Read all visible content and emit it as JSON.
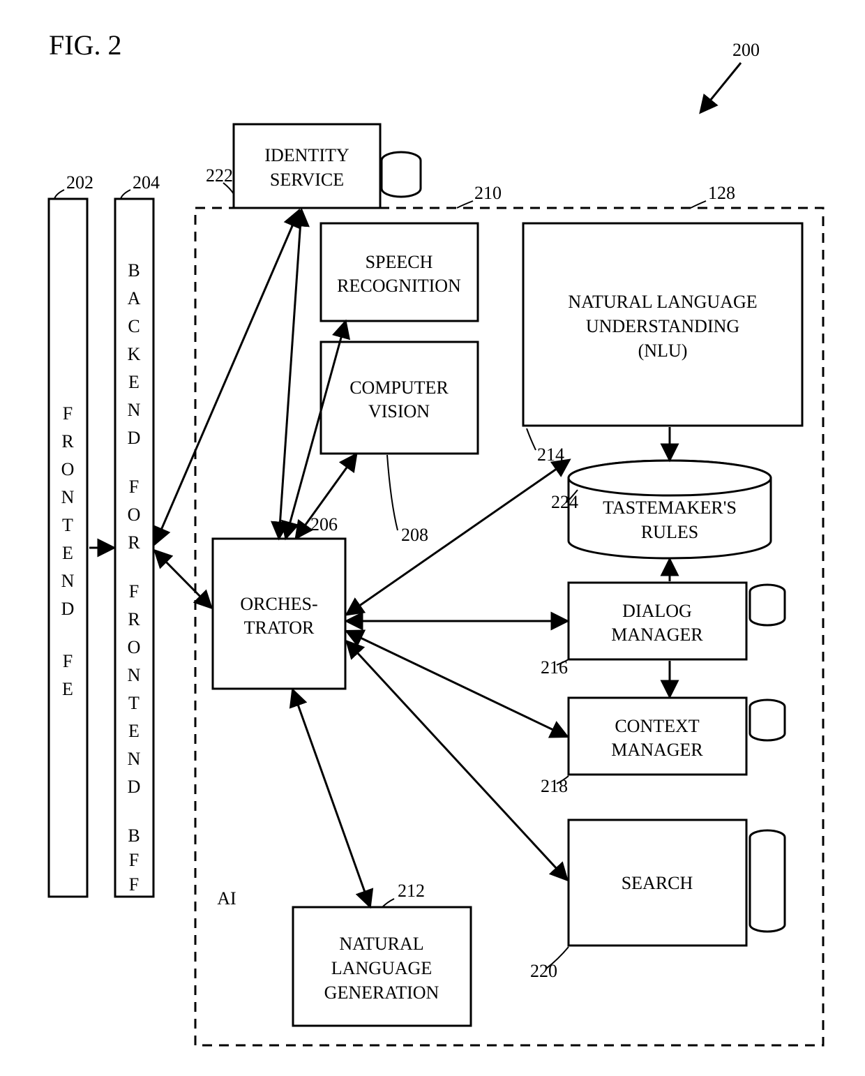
{
  "figure_label": "FIG. 2",
  "callout_200": "200",
  "blocks": {
    "frontend_line1": "FRONTEND",
    "frontend_line2": "FE",
    "bff_line1": "BACKEND",
    "bff_line2": "FOR",
    "bff_line3": "FRONTEND",
    "bff_line4": "BFF",
    "identity_line1": "IDENTITY",
    "identity_line2": "SERVICE",
    "speech_line1": "SPEECH",
    "speech_line2": "RECOGNITION",
    "vision_line1": "COMPUTER",
    "vision_line2": "VISION",
    "orchestrator_line1": "ORCHES-",
    "orchestrator_line2": "TRATOR",
    "nlu_line1": "NATURAL LANGUAGE",
    "nlu_line2": "UNDERSTANDING",
    "nlu_line3": "(NLU)",
    "rules_line1": "TASTEMAKER'S",
    "rules_line2": "RULES",
    "dialog_line1": "DIALOG",
    "dialog_line2": "MANAGER",
    "context_line1": "CONTEXT",
    "context_line2": "MANAGER",
    "search": "SEARCH",
    "nlg_line1": "NATURAL",
    "nlg_line2": "LANGUAGE",
    "nlg_line3": "GENERATION",
    "ai": "AI"
  },
  "refs": {
    "r202": "202",
    "r204": "204",
    "r222": "222",
    "r210": "210",
    "r128": "128",
    "r206": "206",
    "r208": "208",
    "r214": "214",
    "r224": "224",
    "r216": "216",
    "r218": "218",
    "r220": "220",
    "r212": "212"
  }
}
